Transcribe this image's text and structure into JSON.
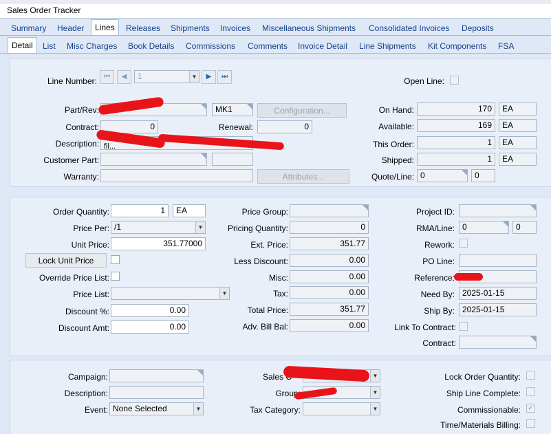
{
  "window": {
    "title": "Sales Order Tracker"
  },
  "tabs_main": [
    "Summary",
    "Header",
    "Lines",
    "Releases",
    "Shipments",
    "Invoices",
    "Miscellaneous Shipments",
    "Consolidated Invoices",
    "Deposits"
  ],
  "tabs_sub": [
    "Detail",
    "List",
    "Misc Charges",
    "Book Details",
    "Commissions",
    "Comments",
    "Invoice Detail",
    "Line Shipments",
    "Kit Components",
    "FSA"
  ],
  "nav": {
    "label": "Line Number:",
    "value": "1",
    "open_line": "Open Line:"
  },
  "part": {
    "part_label": "Part/Rev:",
    "rev": "MK1",
    "config_btn": "Configuration...",
    "contract_label": "Contract:",
    "contract": "0",
    "renewal_label": "Renewal:",
    "renewal": "0",
    "description_label": "Description:",
    "description": "fil...",
    "customer_part_label": "Customer Part:",
    "warranty_label": "Warranty:",
    "attributes_btn": "Attributes...",
    "on_hand_label": "On Hand:",
    "on_hand": "170",
    "on_hand_uom": "EA",
    "available_label": "Available:",
    "available": "169",
    "available_uom": "EA",
    "this_order_label": "This Order:",
    "this_order": "1",
    "this_order_uom": "EA",
    "shipped_label": "Shipped:",
    "shipped": "1",
    "shipped_uom": "EA",
    "quote_label": "Quote/Line:",
    "quote": "0",
    "quote_line": "0"
  },
  "pricing": {
    "order_qty_label": "Order Quantity:",
    "order_qty": "1",
    "order_uom": "EA",
    "price_per_label": "Price Per:",
    "price_per": "/1",
    "unit_price_label": "Unit Price:",
    "unit_price": "351.77000",
    "lock_btn": "Lock Unit Price",
    "override_label": "Override Price List:",
    "price_list_label": "Price List:",
    "discount_pct_label": "Discount %:",
    "discount_pct": "0.00",
    "discount_amt_label": "Discount Amt:",
    "discount_amt": "0.00",
    "price_group_label": "Price Group:",
    "pricing_qty_label": "Pricing Quantity:",
    "pricing_qty": "0",
    "ext_price_label": "Ext. Price:",
    "ext_price": "351.77",
    "less_discount_label": "Less Discount:",
    "less_discount": "0.00",
    "misc_label": "Misc:",
    "misc": "0.00",
    "tax_label": "Tax:",
    "tax": "0.00",
    "total_label": "Total Price:",
    "total": "351.77",
    "adv_bill_label": "Adv. Bill Bal:",
    "adv_bill": "0.00",
    "project_label": "Project ID:",
    "rma_label": "RMA/Line:",
    "rma": "0",
    "rma_line": "0",
    "rework_label": "Rework:",
    "po_line_label": "PO Line:",
    "reference_label": "Reference:",
    "need_by_label": "Need By:",
    "need_by": "2025-01-15",
    "ship_by_label": "Ship By:",
    "ship_by": "2025-01-15",
    "link_contract_label": "Link To Contract:",
    "contract_label": "Contract:"
  },
  "bottom": {
    "campaign_label": "Campaign:",
    "description_label": "Description:",
    "event_label": "Event:",
    "event": "None Selected",
    "sales_cat_label": "Sales C",
    "group_label": "Group:",
    "tax_cat_label": "Tax Category:",
    "lock_qty_label": "Lock Order Quantity:",
    "ship_complete_label": "Ship Line Complete:",
    "commissionable_label": "Commissionable:",
    "time_materials_label": "Time/Materials Billing:"
  }
}
